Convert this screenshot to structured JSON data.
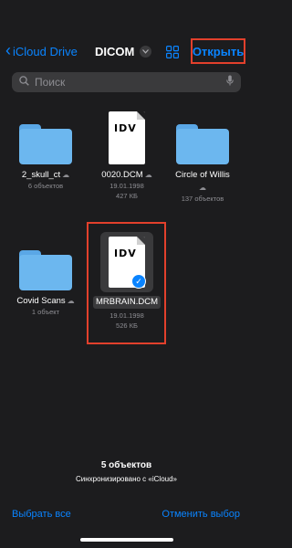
{
  "nav": {
    "back_label": "iCloud Drive",
    "title": "DICOM",
    "open_label": "Открыть"
  },
  "search": {
    "placeholder": "Поиск"
  },
  "items": [
    {
      "name": "2_skull_ct",
      "meta1": "6 объектов",
      "cloud": true
    },
    {
      "name": "0020.DCM",
      "meta1": "19.01.1998",
      "meta2": "427 КБ",
      "doc_text": "IDV"
    },
    {
      "name": "Circle of Willis",
      "meta1": "137 объектов",
      "cloud": true
    },
    {
      "name": "Covid Scans",
      "meta1": "1 объект",
      "cloud": true
    },
    {
      "name": "MRBRAIN.DCM",
      "meta1": "19.01.1998",
      "meta2": "526 КБ",
      "doc_text": "IDV",
      "selected": true
    }
  ],
  "footer": {
    "count": "5 объектов",
    "sync": "Синхронизировано с «iCloud»",
    "select_all": "Выбрать все",
    "deselect": "Отменить выбор"
  },
  "colors": {
    "accent": "#0a84ff",
    "highlight": "#e2402c",
    "folder": "#6cb7ef"
  }
}
